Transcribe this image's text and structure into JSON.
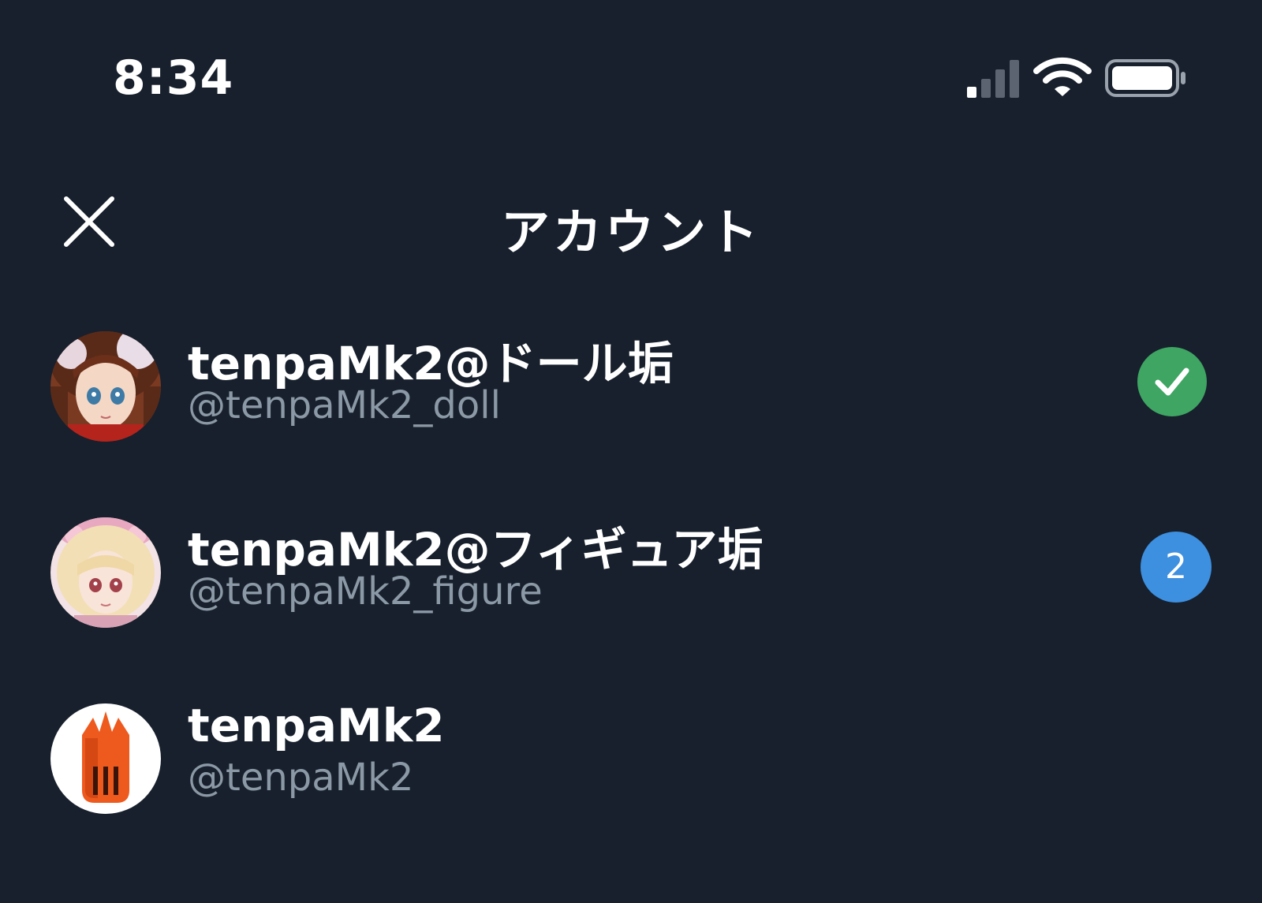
{
  "status_bar": {
    "time": "8:34",
    "icons": [
      "cellular-signal-icon",
      "wifi-icon",
      "battery-icon"
    ]
  },
  "header": {
    "title": "アカウント",
    "close_icon": "close-icon"
  },
  "accounts": [
    {
      "name": "tenpaMk2@ドール垢",
      "handle": "@tenpaMk2_doll",
      "status": "selected",
      "badge_icon": "check-icon",
      "badge_color": "#3ea563"
    },
    {
      "name": "tenpaMk2@フィギュア垢",
      "handle": "@tenpaMk2_figure",
      "status": "unread",
      "badge_count": "2",
      "badge_color": "#3d8fe0"
    },
    {
      "name": "tenpaMk2",
      "handle": "@tenpaMk2",
      "status": "none"
    }
  ],
  "colors": {
    "background": "#17202c",
    "text_primary": "#ffffff",
    "text_secondary": "#8b98a5"
  }
}
